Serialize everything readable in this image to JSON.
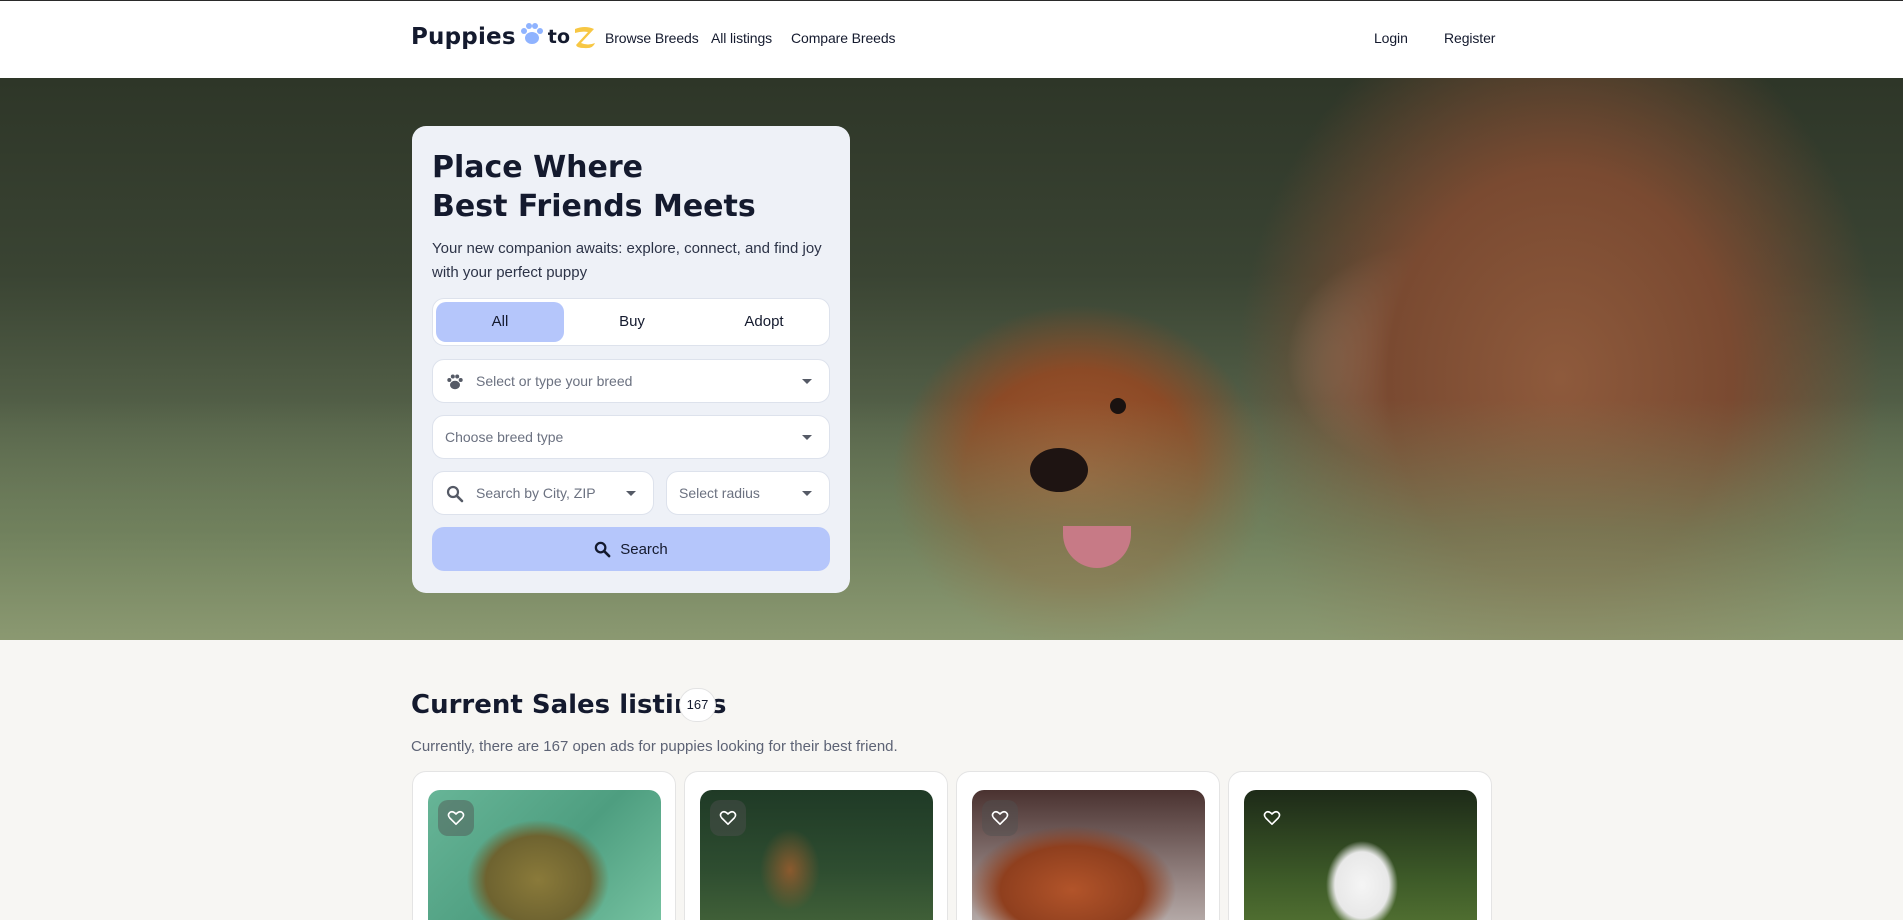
{
  "header": {
    "logo": {
      "part1": "Puppies",
      "part2": "to"
    },
    "nav": [
      {
        "label": "Browse Breeds"
      },
      {
        "label": "All listings"
      },
      {
        "label": "Compare Breeds"
      }
    ],
    "auth": {
      "login": "Login",
      "register": "Register"
    }
  },
  "hero": {
    "title_line1": "Place Where",
    "title_line2": "Best Friends Meets",
    "subtitle": "Your new companion awaits: explore, connect, and find joy with your perfect puppy",
    "tabs": [
      {
        "label": "All",
        "active": true
      },
      {
        "label": "Buy",
        "active": false
      },
      {
        "label": "Adopt",
        "active": false
      }
    ],
    "breed_placeholder": "Select or type your breed",
    "breed_type_placeholder": "Choose breed type",
    "city_placeholder": "Search by City, ZIP",
    "radius_placeholder": "Select radius",
    "search_label": "Search"
  },
  "listings": {
    "title": "Current Sales listings",
    "count": "167",
    "subtitle": "Currently, there are 167 open ads for puppies looking for their best friend."
  },
  "colors": {
    "accent": "#b5c6fb",
    "text": "#141a2e",
    "page_bg": "#f7f6f3",
    "card_bg": "#eef1f7",
    "logo_paw": "#8fb3ff",
    "logo_z": "#f7c744"
  },
  "icons": [
    "paw-icon",
    "search-icon",
    "chevron-down-icon",
    "heart-icon"
  ]
}
